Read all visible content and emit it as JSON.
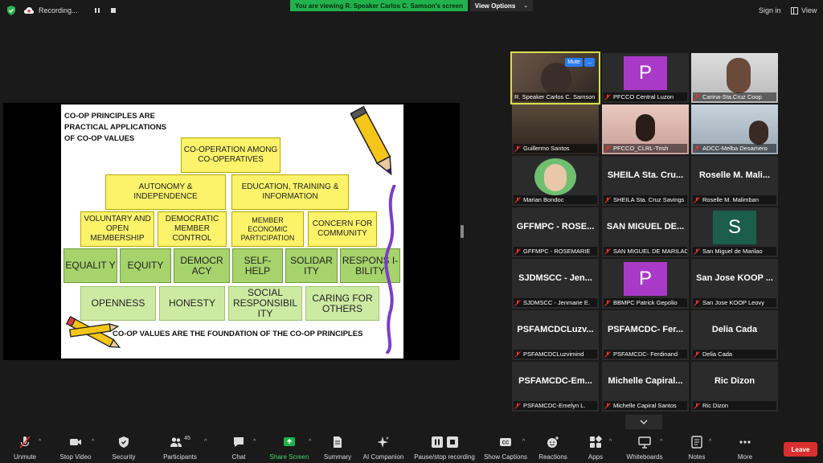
{
  "top": {
    "recording": "Recording...",
    "viewing_banner": "You are viewing R. Speaker Carlos C. Samson's screen",
    "view_options": "View Options",
    "sign_in": "Sign in",
    "view": "View"
  },
  "slide": {
    "title_lines": [
      "CO-OP PRINCIPLES ARE",
      "PRACTICAL APPLICATIONS",
      "OF CO-OP VALUES"
    ],
    "principles": {
      "p1": "CO-OPERATION AMONG CO-OPERATIVES",
      "p2": "AUTONOMY & INDEPENDENCE",
      "p3": "EDUCATION, TRAINING & INFORMATION",
      "p4": "VOLUNTARY AND OPEN MEMBERSHIP",
      "p5": "DEMOCRATIC MEMBER CONTROL",
      "p6": "MEMBER ECONOMIC PARTICIPATION",
      "p7": "CONCERN FOR COMMUNITY"
    },
    "values_row1": [
      "EQUALIT Y",
      "EQUITY",
      "DEMOCR ACY",
      "SELF-HELP",
      "SOLIDAR ITY",
      "RESPONS I-BILITY"
    ],
    "values_row2": [
      "OPENNESS",
      "HONESTY",
      "SOCIAL RESPONSIBIL ITY",
      "CARING FOR OTHERS"
    ],
    "footer": "CO-OP VALUES ARE THE FOUNDATION OF THE CO-OP PRINCIPLES"
  },
  "gallery": {
    "mute_label": "Mute",
    "more_label": "...",
    "avatar_p": "P",
    "avatar_s": "S",
    "tiles": [
      {
        "name": "R. Speaker Carlos C. Samson",
        "big": ""
      },
      {
        "name": "PFCCO Central Luzon",
        "big": ""
      },
      {
        "name": "Carina-Sta.Cruz Coop",
        "big": ""
      },
      {
        "name": "Guillermo Santos",
        "big": ""
      },
      {
        "name": "PFCCO_CLRL-Trish",
        "big": ""
      },
      {
        "name": "ADCC-Melba Desamero",
        "big": ""
      },
      {
        "name": "Marian Bondoc",
        "big": ""
      },
      {
        "name": "SHEILA Sta. Cruz Savings",
        "big": "SHEILA Sta. Cru..."
      },
      {
        "name": "Roselle M. Malimban",
        "big": "Roselle M. Mali..."
      },
      {
        "name": "GFFMPC - ROSEMARIE",
        "big": "GFFMPC - ROSE..."
      },
      {
        "name": "SAN MIGUEL DE MARILAO",
        "big": "SAN MIGUEL DE..."
      },
      {
        "name": "San Miguel de Marilao",
        "big": ""
      },
      {
        "name": "SJDMSCC - Jenmarie E.",
        "big": "SJDMSCC - Jen..."
      },
      {
        "name": "BBMPC Patrick Gepolio",
        "big": ""
      },
      {
        "name": "San Jose KOOP Leovy",
        "big": "San Jose KOOP ..."
      },
      {
        "name": "PSFAMCDCLuzvimind",
        "big": "PSFAMCDCLuzv..."
      },
      {
        "name": "PSFAMCDC- Ferdinand",
        "big": "PSFAMCDC- Fer..."
      },
      {
        "name": "Delia Cada",
        "big": "Delia Cada"
      },
      {
        "name": "PSFAMCDC-Emelyn L.",
        "big": "PSFAMCDC-Em..."
      },
      {
        "name": "Michelle Capiral Santos",
        "big": "Michelle Capiral..."
      },
      {
        "name": "Ric Dizon",
        "big": "Ric Dizon"
      }
    ]
  },
  "toolbar": {
    "unmute": "Unmute",
    "stop_video": "Stop Video",
    "security": "Security",
    "participants": "Participants",
    "participants_count": "45",
    "chat": "Chat",
    "share_screen": "Share Screen",
    "summary": "Summary",
    "ai_companion": "AI Companion",
    "pause_recording": "Pause/stop recording",
    "show_captions": "Show Captions",
    "reactions": "Reactions",
    "apps": "Apps",
    "whiteboards": "Whiteboards",
    "notes": "Notes",
    "more": "More",
    "leave": "Leave"
  },
  "colors": {
    "banner": "#22b14c",
    "accent": "#2d7bf4",
    "leave": "#d9302f",
    "active_border": "#d8e04b"
  }
}
